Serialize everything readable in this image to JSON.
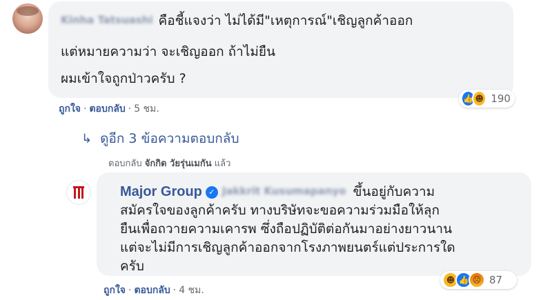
{
  "comment1": {
    "author": "Kinha Tatsuashi",
    "lines": [
      "คือชี้แจงว่า ไม่ได้มี\"เหตุการณ์\"เชิญลูกค้าออก",
      "แต่หมายความว่า จะเชิญออก ถ้าไม่ยืน",
      "ผมเข้าใจถูกป่าวครับ ?"
    ],
    "reaction_count": "190",
    "reaction_icons": [
      "like-icon",
      "haha-icon"
    ],
    "actions": {
      "like": "ถูกใจ",
      "reply": "ตอบกลับ",
      "time": "5 ชม."
    }
  },
  "more_replies": "ดูอีก 3 ข้อความตอบกลับ",
  "reply_mention": {
    "prefix": "ตอบกลับ",
    "name": "จักกิด วัยรุ่นเมกัน",
    "suffix": "แล้ว"
  },
  "comment2": {
    "author": "Major Group",
    "mentioned": "Jakkrit Kusumapanyo",
    "lines": [
      "ขึ้นอยู่กับความ",
      "สมัครใจของลูกค้าครับ ทางบริษัทจะขอความร่วมมือให้ลุก",
      "ยืนเพื่อถวายความเคารพ ซึ่งถือปฏิบัติต่อกันมาอย่างยาวนาน",
      "แต่จะไม่มีการเชิญลูกค้าออกจากโรงภาพยนตร์แต่ประการใด",
      "ครับ"
    ],
    "reaction_count": "87",
    "reaction_icons": [
      "haha-icon",
      "like-icon",
      "angry-icon"
    ],
    "actions": {
      "like": "ถูกใจ",
      "reply": "ตอบกลับ",
      "time": "4 ชม."
    }
  },
  "colors": {
    "link": "#385898",
    "bubble": "#f2f3f5",
    "like": "#1877f2",
    "brand_red": "#c4161c"
  }
}
